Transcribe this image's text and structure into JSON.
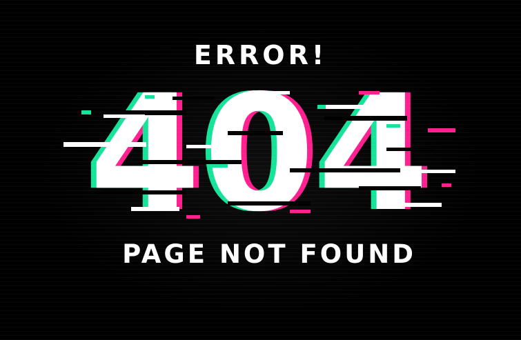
{
  "page": {
    "heading": "ERROR!",
    "code": "404",
    "subheading": "PAGE NOT FOUND"
  },
  "theme": {
    "background": "#000000",
    "text": "#ffffff",
    "glitch_pink": "#ff1f8e",
    "glitch_green": "#16e39a"
  }
}
